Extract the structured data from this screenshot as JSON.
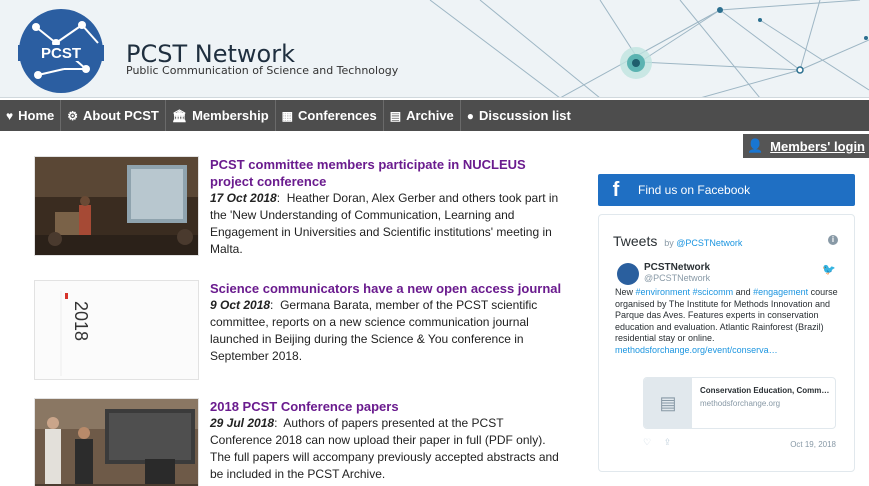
{
  "header": {
    "logo_text": "PCST",
    "title": "PCST Network",
    "subtitle": "Public Communication of Science and Technology"
  },
  "nav": {
    "items": [
      {
        "label": "Home",
        "icon": "heart-icon"
      },
      {
        "label": "About PCST",
        "icon": "gears-icon"
      },
      {
        "label": "Membership",
        "icon": "institution-icon"
      },
      {
        "label": "Conferences",
        "icon": "calendar-icon"
      },
      {
        "label": "Archive",
        "icon": "document-icon"
      },
      {
        "label": "Discussion list",
        "icon": "comments-icon"
      }
    ]
  },
  "members_login": {
    "label": "Members' login",
    "icon": "user-icon"
  },
  "articles": [
    {
      "title": "PCST committee members participate in NUCLEUS project conference",
      "date": "17 Oct 2018",
      "text": "Heather Doran, Alex Gerber and others took part in the 'New Understanding of Communication, Learning and Engagement in Universities and Scientific institutions' meeting in Malta."
    },
    {
      "title": "Science communicators have a new open access journal",
      "date": "9 Oct 2018",
      "text": "Germana Barata, member of the PCST scientific committee, reports on a new science communication journal launched in Beijing during the Science & You conference in September 2018.",
      "thumb_text": "2018"
    },
    {
      "title": "2018 PCST Conference papers",
      "date": "29 Jul 2018",
      "text": "Authors of papers presented at the PCST Conference 2018 can now upload their paper in full (PDF only). The full papers will accompany previously accepted abstracts and be included in the PCST Archive."
    }
  ],
  "facebook": {
    "label": "Find us on Facebook",
    "icon": "facebook-icon"
  },
  "tweets": {
    "heading": "Tweets",
    "by": "by",
    "by_handle": "@PCSTNetwork",
    "tweet": {
      "name": "PCSTNetwork",
      "handle": "@PCSTNetwork",
      "t1": "New ",
      "tag1": "#environment",
      "t2": " ",
      "tag2": "#scicomm",
      "t3": " and ",
      "tag3": "#engagement",
      "t4": " course organised by The Institute for Methods Innovation and Parque das Aves. Features experts in conservation education and evaluation. Atlantic Rainforest (Brazil) residential stay or online. ",
      "link": "methodsforchange.org/event/conserva…",
      "card_title": "Conservation Education, Comm…",
      "card_domain": "methodsforchange.org",
      "date": "Oct 19, 2018"
    }
  }
}
